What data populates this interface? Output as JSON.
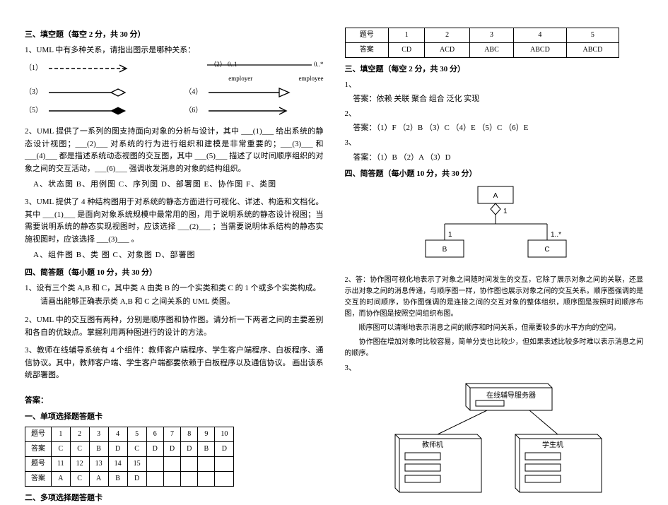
{
  "left": {
    "sec3_title": "三、填空题（每空 2 分，共 30 分）",
    "q1": "1、UML 中有多种关系，请指出图示是哪种关系：",
    "arrow_labels": {
      "a1": "（1）",
      "a2": "（2）",
      "a3": "（3）",
      "a4": "（4）",
      "a5": "（5）",
      "a6": "（6）"
    },
    "cell2": {
      "l": "0..1",
      "r": "0..*",
      "le": "employer",
      "re": "employee"
    },
    "q2": "2、UML 提供了一系列的图支持面向对象的分析与设计，其中 ___(1)___ 给出系统的静态设计视图；___(2)___ 对系统的行为进行组织和建模是非常重要的；___(3)___ 和 ___(4)___ 都是描述系统动态视图的交互图，其中 ___(5)___ 描述了以时间顺序组织的对象之间的交互活动，___(6)___ 强调收发消息的对象的结构组织。",
    "q2_opts": "A、状态图    B、用例图    C、序列图    D、部署图    E、协作图    F、类图",
    "q3": "3、UML 提供了 4 种结构图用于对系统的静态方面进行可视化、详述、构造和文档化。其中 ___(1)___ 是面向对象系统规模中最常用的图，用于说明系统的静态设计视图；当需要说明系统的静态实现视图时，应该选择 ___(2)___ ；当需要说明体系结构的静态实施视图时，应该选择 ___(3)___ 。",
    "q3_opts": "A、组件图    B、类 图    C、对象图    D、部署图",
    "sec4_title": "四、简答题（每小题 10 分，共 30 分）",
    "q4_1a": "1、设有三个类 A,B 和 C，其中类 A 由类 B 的一个实类和类 C 的 1 个或多个实类构成。",
    "q4_1b": "请画出能够正确表示类 A,B 和 C 之间关系的 UML 类图。",
    "q4_2": "2、UML 中的交互图有两种，分别是顺序图和协作图。请分析一下两者之间的主要差别和各自的优缺点。掌握利用两种图进行的设计的方法。",
    "q4_3": "3、教师在线辅导系统有 4 个组件：教师客户端程序、学生客户端程序、白板程序、通信协议。其中，教师客户端、学生客户端都要依赖于白板程序以及通信协议。 画出该系统部署图。",
    "ans_title": "答案：",
    "tab1_title": "一、单项选择题答题卡",
    "table1": {
      "hdr": "题号",
      "hdr2": "答案",
      "rows": [
        [
          "1",
          "2",
          "3",
          "4",
          "5",
          "6",
          "7",
          "8",
          "9",
          "10"
        ],
        [
          "C",
          "C",
          "B",
          "D",
          "C",
          "D",
          "D",
          "D",
          "B",
          "D"
        ],
        [
          "11",
          "12",
          "13",
          "14",
          "15",
          "",
          "",
          "",
          "",
          ""
        ],
        [
          "A",
          "C",
          "A",
          "B",
          "D",
          "",
          "",
          "",
          "",
          ""
        ]
      ]
    },
    "tab2_title": "二、多项选择题答题卡"
  },
  "right": {
    "table2": {
      "hdr": "题号",
      "hdr2": "答案",
      "cols": [
        "1",
        "2",
        "3",
        "4",
        "5"
      ],
      "ans": [
        "CD",
        "ACD",
        "ABC",
        "ABCD",
        "ABCD"
      ]
    },
    "sec3_title": "三、填空题（每空 2 分，共 30 分）",
    "ans1_lbl": "1、",
    "ans1": "答案：依赖    关联    聚合    组合    泛化    实现",
    "ans2_lbl": "2、",
    "ans2": "答案：（1）F  （2）B  （3）C  （4）E    （5）C  （6）E",
    "ans3_lbl": "3、",
    "ans3": "答案：（1）B （2）A    （3）D",
    "sec4_title": "四、简答题（每小题 10 分，共 30 分）",
    "diag1": {
      "A": "A",
      "B": "B",
      "C": "C",
      "m1": "1",
      "m2": "1",
      "m3": "1..*"
    },
    "p2a": "2、答：协作图可视化地表示了对象之间随时间发生的交互，它除了展示对象之间的关联，还显示出对象之间的消息传递，与顺序图一样，协作图也展示对象之间的交互关系。顺序图强调的是交互的时间顺序，协作图强调的是连接之间的交互对象的整体组织，顺序图是按照时间顺序布图，而协作图是按照空间组织布图。",
    "p2b": "顺序图可以清晰地表示消息之间的顺序和时间关系，但需要较多的水平方向的空间。",
    "p2c": "协作图在增加对象时比较容易，简单分支也比较少，但如果表述比较多时难以表示消息之间的顺序。",
    "p3_lbl": "3、",
    "deploy": {
      "server": "在线辅导服务器",
      "teacher": "教师机",
      "student": "学生机"
    }
  }
}
